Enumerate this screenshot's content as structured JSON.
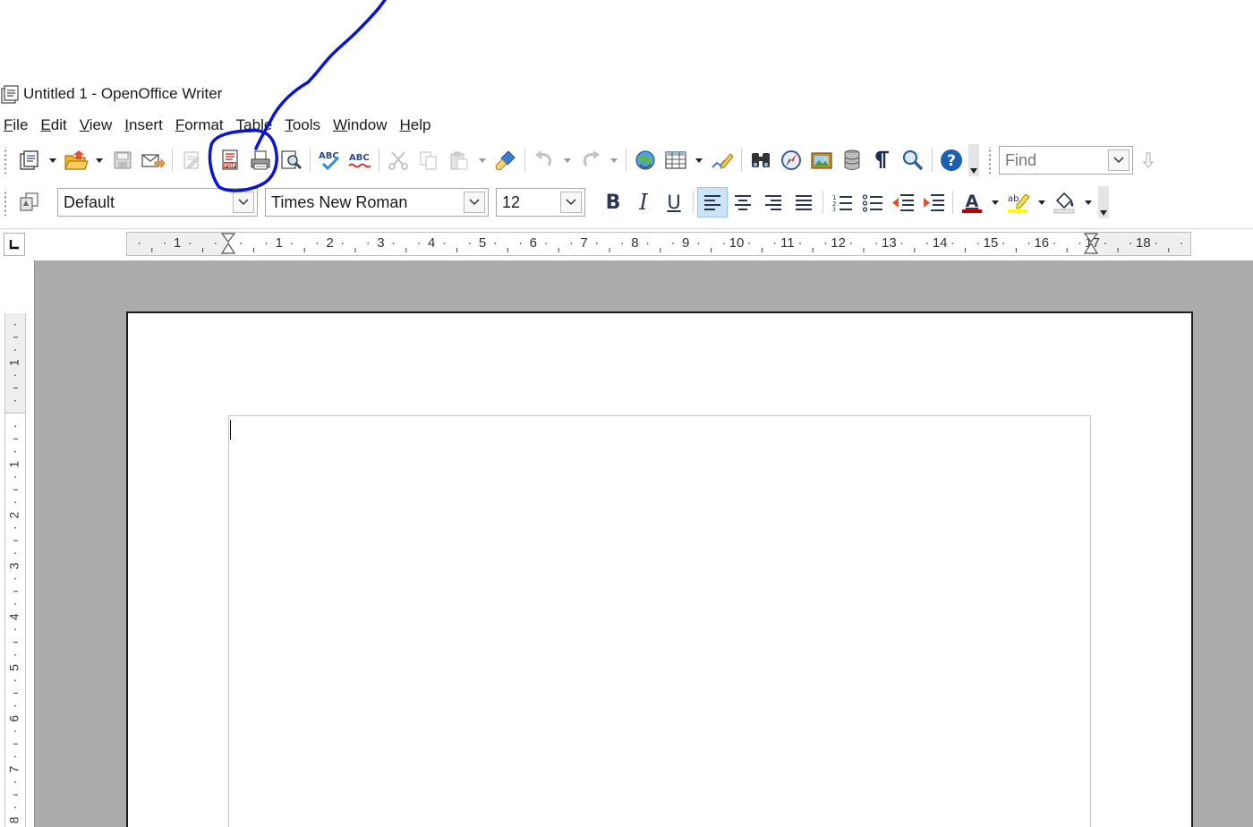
{
  "window": {
    "title": "Untitled 1 - OpenOffice Writer"
  },
  "menu": [
    {
      "label": "File",
      "key": "file"
    },
    {
      "label": "Edit",
      "key": "edit"
    },
    {
      "label": "View",
      "key": "view"
    },
    {
      "label": "Insert",
      "key": "insert"
    },
    {
      "label": "Format",
      "key": "format"
    },
    {
      "label": "Table",
      "key": "table"
    },
    {
      "label": "Tools",
      "key": "tools"
    },
    {
      "label": "Window",
      "key": "window"
    },
    {
      "label": "Help",
      "key": "help"
    }
  ],
  "standard_toolbar": {
    "icons": [
      "new-document-icon",
      "open-folder-icon",
      "save-icon",
      "email-icon",
      "edit-file-icon",
      "export-pdf-icon",
      "print-icon",
      "page-preview-icon",
      "spellcheck-icon",
      "autospellcheck-icon",
      "cut-icon",
      "copy-icon",
      "paste-icon",
      "clone-formatting-icon",
      "undo-icon",
      "redo-icon",
      "hyperlink-icon",
      "table-icon",
      "draw-functions-icon",
      "find-replace-icon",
      "navigator-icon",
      "gallery-icon",
      "data-sources-icon",
      "formatting-marks-icon",
      "zoom-icon",
      "help-icon"
    ],
    "find_placeholder": "Find"
  },
  "formatting_toolbar": {
    "paragraph_style": "Default",
    "font_name": "Times New Roman",
    "font_size": "12",
    "bold_label": "B",
    "italic_label": "I",
    "underline_label": "U",
    "active_alignment": "align-left",
    "font_color": "#c00000",
    "highlight_color": "#ffff00"
  },
  "ruler": {
    "horizontal_labels": [
      "1",
      "1",
      "2",
      "3",
      "4",
      "5",
      "6",
      "7",
      "8",
      "9",
      "10",
      "11",
      "12",
      "13",
      "14",
      "15",
      "16",
      "17",
      "18"
    ],
    "vertical_labels": [
      "1",
      "1",
      "2",
      "3",
      "4",
      "5",
      "6",
      "7",
      "8"
    ]
  },
  "colors": {
    "workspace": "#ababab",
    "annotation_pen": "#0a14d4",
    "help_blue": "#1e5fb4"
  }
}
